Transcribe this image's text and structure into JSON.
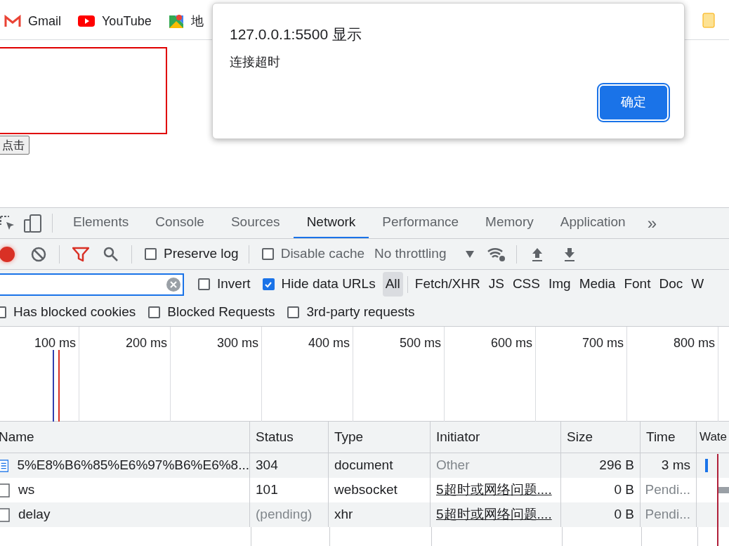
{
  "bookmarks": [
    {
      "label": "Gmail",
      "kind": "mail"
    },
    {
      "label": "YouTube",
      "kind": "play"
    },
    {
      "label": "地",
      "kind": "map"
    }
  ],
  "page": {
    "button": "点击"
  },
  "dialog": {
    "title": "127.0.0.1:5500 显示",
    "message": "连接超时",
    "ok": "确定"
  },
  "devtools": {
    "tabs": [
      {
        "label": "Elements",
        "selected": false
      },
      {
        "label": "Console",
        "selected": false
      },
      {
        "label": "Sources",
        "selected": false
      },
      {
        "label": "Network",
        "selected": true
      },
      {
        "label": "Performance",
        "selected": false
      },
      {
        "label": "Memory",
        "selected": false
      },
      {
        "label": "Application",
        "selected": false
      }
    ],
    "more": "»",
    "toolbar": {
      "recording": true,
      "preserve_log": {
        "label": "Preserve log",
        "checked": false
      },
      "disable_cache": {
        "label": "Disable cache",
        "checked": false
      },
      "throttling": "No throttling"
    },
    "filter": {
      "invert": {
        "label": "Invert",
        "checked": false
      },
      "hide_data_urls": {
        "label": "Hide data URLs",
        "checked": true
      },
      "types": [
        {
          "label": "All",
          "selected": true
        },
        {
          "label": "Fetch/XHR",
          "selected": false
        },
        {
          "label": "JS",
          "selected": false
        },
        {
          "label": "CSS",
          "selected": false
        },
        {
          "label": "Img",
          "selected": false
        },
        {
          "label": "Media",
          "selected": false
        },
        {
          "label": "Font",
          "selected": false
        },
        {
          "label": "Doc",
          "selected": false
        },
        {
          "label": "W",
          "selected": false
        }
      ]
    },
    "options": [
      {
        "label": "Has blocked cookies",
        "checked": false
      },
      {
        "label": "Blocked Requests",
        "checked": false
      },
      {
        "label": "3rd-party requests",
        "checked": false
      }
    ],
    "timeline": [
      "100 ms",
      "200 ms",
      "300 ms",
      "400 ms",
      "500 ms",
      "600 ms",
      "700 ms",
      "800 ms"
    ],
    "table": {
      "columns": [
        "Name",
        "Status",
        "Type",
        "Initiator",
        "Size",
        "Time",
        "Wate"
      ],
      "rows": [
        {
          "kind": "document",
          "cells": [
            {
              "text": "5%E8%B6%85%E6%97%B6%E6%8...",
              "muted": false,
              "link": false
            },
            {
              "text": "304",
              "muted": false,
              "link": false
            },
            {
              "text": "document",
              "muted": false,
              "link": false
            },
            {
              "text": "Other",
              "muted": true,
              "link": false
            },
            {
              "text": "296 B",
              "muted": false,
              "link": false
            },
            {
              "text": "3 ms",
              "muted": false,
              "link": false
            }
          ]
        },
        {
          "kind": "websocket",
          "cells": [
            {
              "text": "ws",
              "muted": false,
              "link": false
            },
            {
              "text": "101",
              "muted": false,
              "link": false
            },
            {
              "text": "websocket",
              "muted": false,
              "link": false
            },
            {
              "text": "5超时或网络问题....",
              "muted": false,
              "link": true
            },
            {
              "text": "0 B",
              "muted": false,
              "link": false
            },
            {
              "text": "Pendi...",
              "muted": true,
              "link": false
            }
          ]
        },
        {
          "kind": "xhr",
          "cells": [
            {
              "text": "delay",
              "muted": false,
              "link": false
            },
            {
              "text": "(pending)",
              "muted": true,
              "link": false
            },
            {
              "text": "xhr",
              "muted": false,
              "link": false
            },
            {
              "text": "5超时或网络问题....",
              "muted": false,
              "link": true
            },
            {
              "text": "0 B",
              "muted": false,
              "link": false
            },
            {
              "text": "Pendi...",
              "muted": true,
              "link": false
            }
          ]
        }
      ]
    }
  }
}
